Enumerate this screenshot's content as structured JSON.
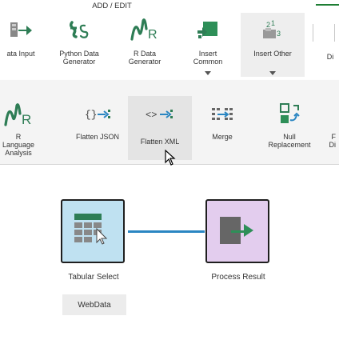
{
  "ribbon": {
    "section_title": "ADD / EDIT",
    "buttons": [
      {
        "id": "data-input",
        "label": "ata Input",
        "icon": "data-input-icon"
      },
      {
        "id": "python-data-generator",
        "label": "Python Data\nGenerator",
        "icon": "python-icon"
      },
      {
        "id": "r-data-generator",
        "label": "R Data\nGenerator",
        "icon": "r-icon"
      },
      {
        "id": "insert-common",
        "label": "Insert\nCommon",
        "icon": "insert-common-icon"
      },
      {
        "id": "insert-other",
        "label": "Insert Other",
        "icon": "insert-other-icon"
      },
      {
        "id": "di",
        "label": "Di",
        "icon": ""
      }
    ]
  },
  "panel": {
    "buttons": [
      {
        "id": "r-language-analysis",
        "label": "R Language\nAnalysis",
        "icon": "r-icon"
      },
      {
        "id": "flatten-json",
        "label": "Flatten JSON",
        "icon": "json-icon"
      },
      {
        "id": "flatten-xml",
        "label": "Flatten XML",
        "icon": "xml-icon"
      },
      {
        "id": "merge",
        "label": "Merge",
        "icon": "merge-icon"
      },
      {
        "id": "null-replacement",
        "label": "Null\nReplacement",
        "icon": "null-replacement-icon"
      },
      {
        "id": "partial",
        "label": "F\nDi",
        "icon": ""
      }
    ]
  },
  "canvas": {
    "nodes": [
      {
        "id": "tabular-select",
        "label": "Tabular Select",
        "icon": "tabular-select-icon"
      },
      {
        "id": "process-result",
        "label": "Process Result",
        "icon": "process-result-icon"
      }
    ],
    "chip_label": "WebData"
  },
  "colors": {
    "accent_green": "#1e7e34",
    "r_green": "#2e7d55",
    "json_blue": "#2a86c2",
    "node_blue": "#bfe1f1",
    "node_purple": "#e3cdee"
  }
}
